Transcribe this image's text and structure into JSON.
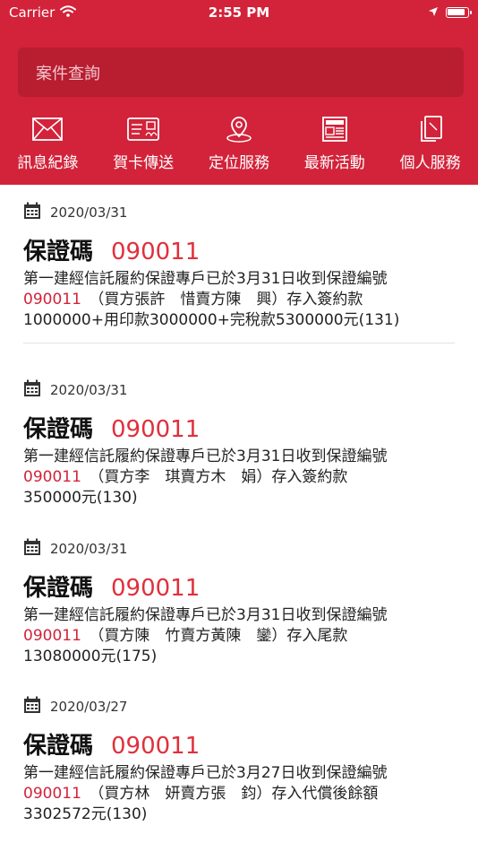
{
  "status_bar": {
    "carrier": "Carrier",
    "time": "2:55 PM",
    "battery_level": 0.9
  },
  "search": {
    "placeholder": "案件查詢"
  },
  "nav": [
    {
      "label": "訊息紀錄",
      "icon": "envelope-icon"
    },
    {
      "label": "賀卡傳送",
      "icon": "greeting-card-icon"
    },
    {
      "label": "定位服務",
      "icon": "location-pin-icon"
    },
    {
      "label": "最新活動",
      "icon": "newspaper-icon"
    },
    {
      "label": "個人服務",
      "icon": "documents-icon"
    }
  ],
  "messages": [
    {
      "date": "2020/03/31",
      "title_label": "保證碼",
      "title_code": "090011",
      "line1": "第一建經信託履約保證專戶已於3月31日收到保證編號",
      "code": "090011",
      "line2_rest": "（買方張許　惜賣方陳　興）存入簽約款",
      "line3": "1000000+用印款3000000+完稅款5300000元(131)"
    },
    {
      "date": "2020/03/31",
      "title_label": "保證碼",
      "title_code": "090011",
      "line1": "第一建經信託履約保證專戶已於3月31日收到保證編號",
      "code": "090011",
      "line2_rest": "（買方李　琪賣方木　娟）存入簽約款",
      "line3": "350000元(130)"
    },
    {
      "date": "2020/03/31",
      "title_label": "保證碼",
      "title_code": "090011",
      "line1": "第一建經信託履約保證專戶已於3月31日收到保證編號",
      "code": "090011",
      "line2_rest": "（買方陳　竹賣方黃陳　鑾）存入尾款",
      "line3": "13080000元(175)"
    },
    {
      "date": "2020/03/27",
      "title_label": "保證碼",
      "title_code": "090011",
      "line1": "第一建經信託履約保證專戶已於3月27日收到保證編號",
      "code": "090011",
      "line2_rest": "（買方林　妍賣方張　鈞）存入代償後餘額",
      "line3": "3302572元(130)"
    }
  ],
  "colors": {
    "brand": "#d2233a",
    "code": "#e0303c"
  }
}
